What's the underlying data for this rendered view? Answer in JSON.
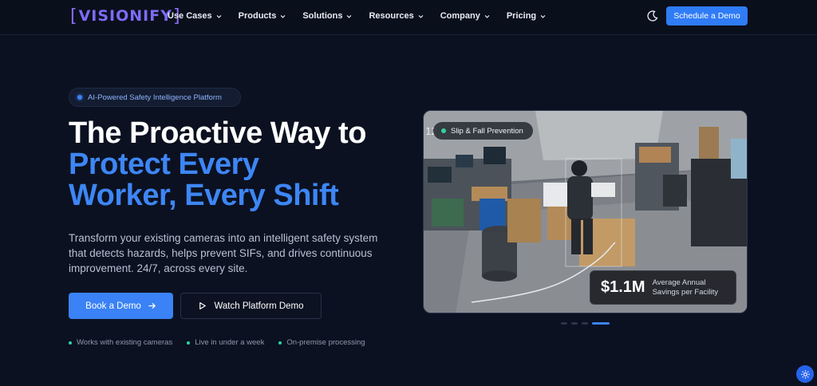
{
  "nav": {
    "logo": "VISIONIFY",
    "items": [
      {
        "label": "Use Cases"
      },
      {
        "label": "Products"
      },
      {
        "label": "Solutions"
      },
      {
        "label": "Resources"
      },
      {
        "label": "Company"
      },
      {
        "label": "Pricing"
      }
    ],
    "theme_icon": "moon-icon",
    "cta_label": "Schedule a Demo"
  },
  "hero": {
    "badge": "AI-Powered Safety Intelligence Platform",
    "title_line1": "The Proactive Way to",
    "title_line2": "Protect Every",
    "title_line3": "Worker, Every Shift",
    "subtitle": "Transform your existing cameras into an intelligent safety system that detects hazards, helps prevent SIFs, and drives continuous improvement. 24/7, across every site.",
    "primary_button": "Book a Demo",
    "secondary_button": "Watch Platform Demo",
    "features": [
      "Works with existing cameras",
      "Live in under a week",
      "On-premise processing"
    ]
  },
  "media": {
    "tag": "Slip & Fall Prevention",
    "camera_text": "12",
    "stat_value": "$1.1M",
    "stat_label_line1": "Average Annual",
    "stat_label_line2": "Savings per Facility",
    "carousel_count": 4,
    "carousel_active": 4
  },
  "colors": {
    "background": "#0b1120",
    "accent": "#3a82f5",
    "highlight_text": "#3d86f5",
    "feature_dot": "#2dd4a0",
    "logo": "#7b6cf6"
  },
  "icons": {
    "chevron": "chevron-down-icon",
    "arrow": "arrow-right-icon",
    "play": "play-icon",
    "settings": "gear-icon"
  }
}
